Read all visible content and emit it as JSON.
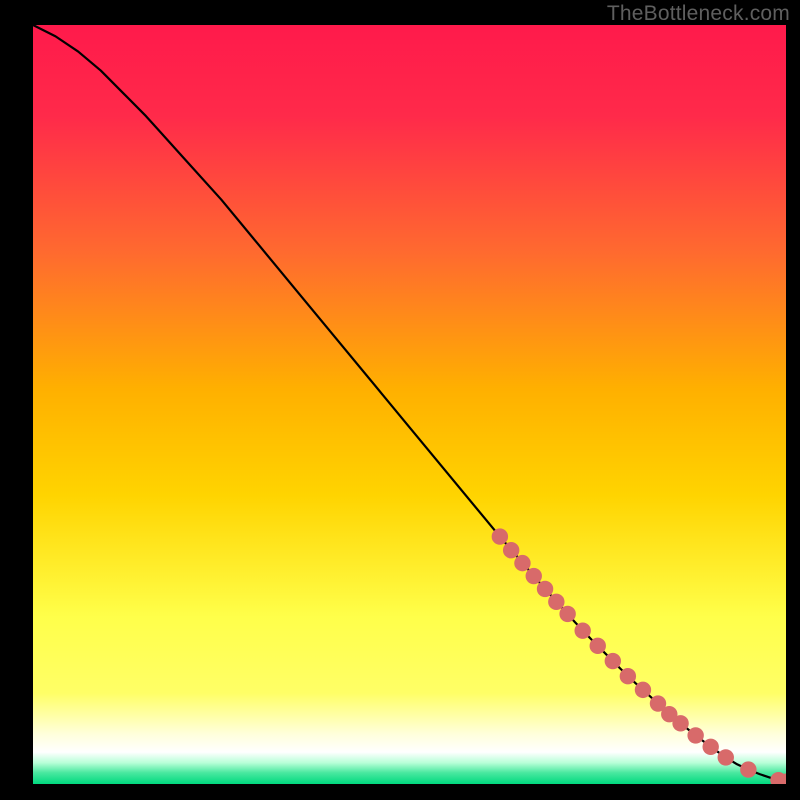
{
  "watermark": "TheBottleneck.com",
  "colors": {
    "gradient_top": "#ff1a4b",
    "gradient_mid1": "#ff7a2a",
    "gradient_mid2": "#ffd400",
    "gradient_mid3": "#ffff66",
    "gradient_mid4": "#ffffdd",
    "gradient_bottom": "#00d97e",
    "curve": "#000000",
    "marker_fill": "#d86a6a",
    "marker_stroke": "#b24f4f"
  },
  "chart_data": {
    "type": "line",
    "title": "",
    "xlabel": "",
    "ylabel": "",
    "xlim": [
      0,
      100
    ],
    "ylim": [
      0,
      100
    ],
    "series": [
      {
        "name": "bottleneck-curve",
        "x": [
          0,
          3,
          6,
          9,
          12,
          15,
          20,
          25,
          30,
          35,
          40,
          45,
          50,
          55,
          60,
          62,
          64,
          66,
          68,
          70,
          72,
          74,
          76,
          78,
          80,
          82,
          84,
          86,
          88,
          90,
          92,
          93.5,
          95,
          96.5,
          98,
          99,
          100
        ],
        "y": [
          100,
          98.5,
          96.5,
          94,
          91,
          88,
          82.5,
          77,
          71,
          65,
          59,
          53,
          47,
          41,
          35,
          32.6,
          30.3,
          28,
          25.7,
          23.5,
          21.3,
          19.2,
          17.2,
          15.2,
          13.3,
          11.5,
          9.7,
          8.0,
          6.4,
          4.9,
          3.5,
          2.6,
          1.9,
          1.3,
          0.8,
          0.5,
          0.3
        ]
      }
    ],
    "markers": {
      "name": "highlighted-points",
      "x": [
        62,
        63.5,
        65,
        66.5,
        68,
        69.5,
        71,
        73,
        75,
        77,
        79,
        81,
        83,
        84.5,
        86,
        88,
        90,
        92,
        95,
        99,
        100
      ],
      "y": [
        32.6,
        30.8,
        29.1,
        27.4,
        25.7,
        24.0,
        22.4,
        20.2,
        18.2,
        16.2,
        14.2,
        12.4,
        10.6,
        9.2,
        8.0,
        6.4,
        4.9,
        3.5,
        1.9,
        0.5,
        0.3
      ]
    }
  }
}
